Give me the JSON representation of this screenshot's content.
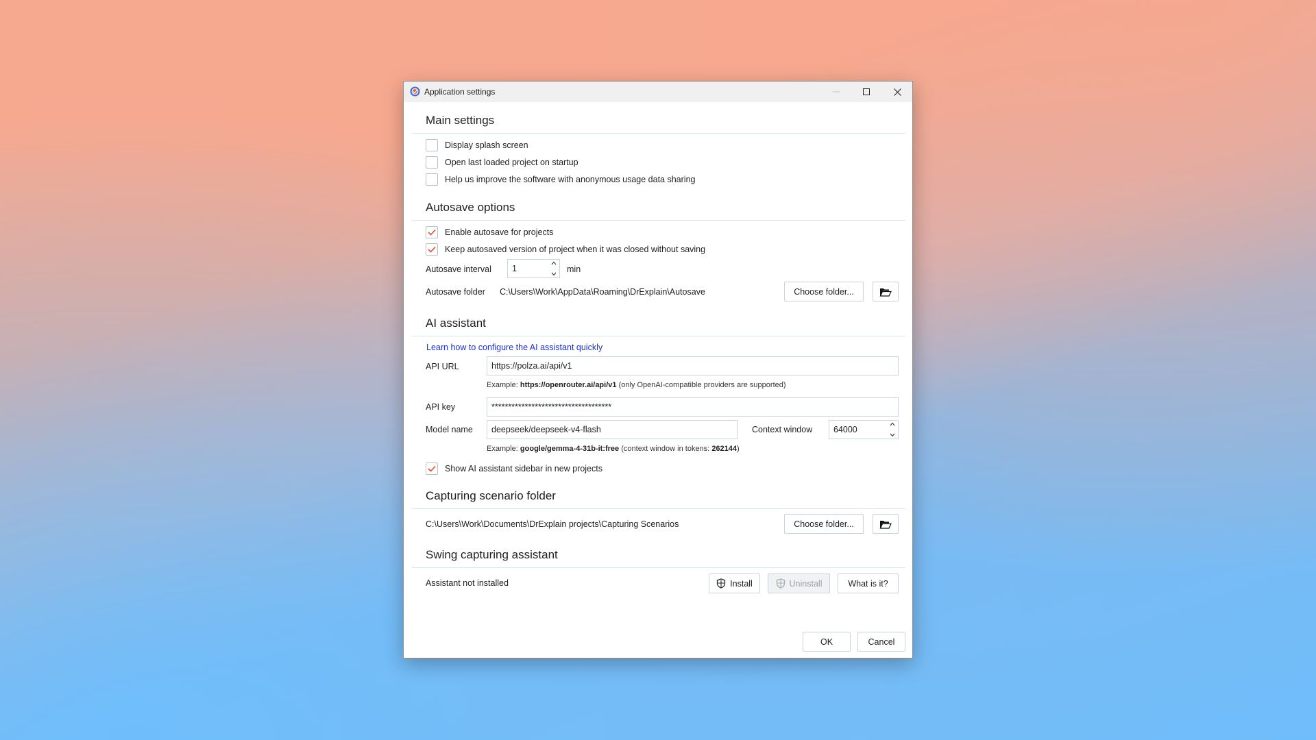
{
  "window": {
    "title": "Application settings"
  },
  "main_settings": {
    "title": "Main settings",
    "options": [
      {
        "label": "Display splash screen",
        "checked": false
      },
      {
        "label": "Open last loaded project on startup",
        "checked": false
      },
      {
        "label": "Help us improve the software with anonymous usage data sharing",
        "checked": false
      }
    ]
  },
  "autosave": {
    "title": "Autosave options",
    "options": [
      {
        "label": "Enable autosave for projects",
        "checked": true
      },
      {
        "label": "Keep autosaved version of project when it was closed without saving",
        "checked": true
      }
    ],
    "interval_label": "Autosave interval",
    "interval_value": "1",
    "interval_unit": "min",
    "folder_label": "Autosave folder",
    "folder_path": "C:\\Users\\Work\\AppData\\Roaming\\DrExplain\\Autosave",
    "choose_folder_label": "Choose folder..."
  },
  "ai": {
    "title": "AI assistant",
    "learn_link": "Learn how to configure the AI assistant quickly",
    "api_url_label": "API URL",
    "api_url_value": "https://polza.ai/api/v1",
    "api_url_example_prefix": "Example:",
    "api_url_example_value": "https://openrouter.ai/api/v1",
    "api_url_example_note": "(only OpenAI-compatible providers are supported)",
    "api_key_label": "API key",
    "api_key_value": "************************************",
    "model_label": "Model name",
    "model_value": "deepseek/deepseek-v4-flash",
    "context_label": "Context window",
    "context_value": "64000",
    "model_example_prefix": "Example:",
    "model_example_value": "google/gemma-4-31b-it:free",
    "model_example_note_open": "(context window in tokens:",
    "model_example_tokens": "262144",
    "model_example_note_close": ")",
    "sidebar_option": {
      "label": "Show AI assistant sidebar in new projects",
      "checked": true
    }
  },
  "capturing": {
    "title": "Capturing scenario folder",
    "folder_path": "C:\\Users\\Work\\Documents\\DrExplain projects\\Capturing Scenarios",
    "choose_folder_label": "Choose folder..."
  },
  "swing": {
    "title": "Swing capturing assistant",
    "status": "Assistant not installed",
    "install_label": "Install",
    "uninstall_label": "Uninstall",
    "what_label": "What is it?"
  },
  "footer": {
    "ok_label": "OK",
    "cancel_label": "Cancel"
  },
  "colors": {
    "checkmark": "#e0492c",
    "link": "#1f2fd6",
    "separator": "#dbe3ee"
  }
}
